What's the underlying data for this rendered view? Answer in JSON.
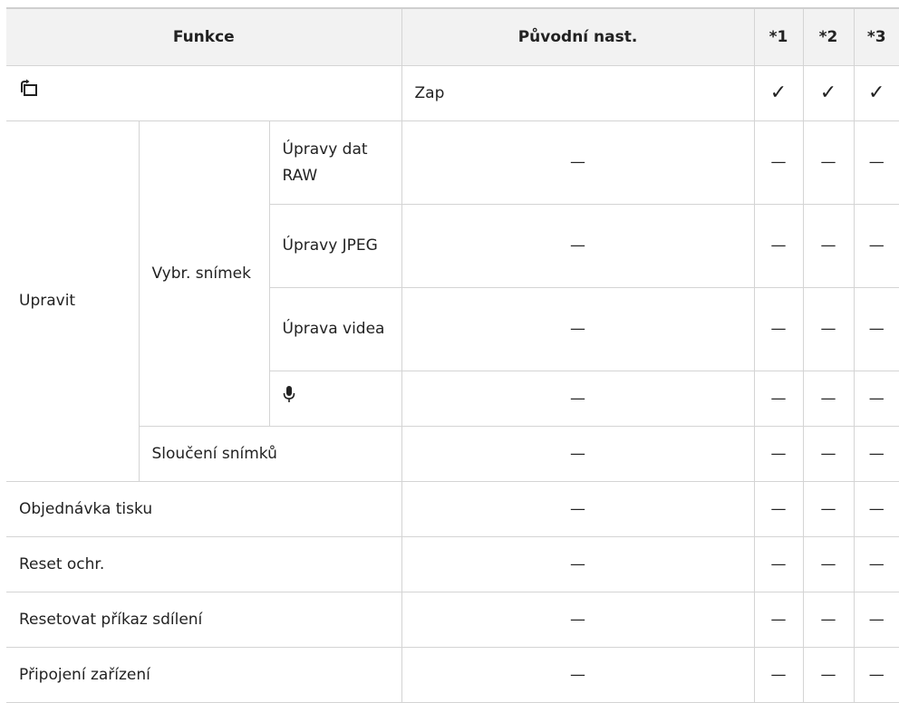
{
  "table": {
    "headers": {
      "func": "Funkce",
      "default": "Původní nast.",
      "s1": "*1",
      "s2": "*2",
      "s3": "*3"
    },
    "rows": {
      "rotate": {
        "icon": "rotate-icon",
        "default": "Zap",
        "marks": [
          "✓",
          "✓",
          "✓"
        ]
      },
      "edit": {
        "label": "Upravit",
        "select": "Vybr. snímek",
        "raw": "Úpravy dat RAW",
        "jpeg": "Úpravy JPEG",
        "video": "Úprava videa",
        "mic_icon": "microphone-icon",
        "merge": "Sloučení snímků"
      },
      "print": "Objednávka tisku",
      "reset_protect": "Reset ochr.",
      "reset_share": "Resetovat příkaz sdílení",
      "connect": "Připojení zařízení"
    },
    "dash": "—"
  }
}
